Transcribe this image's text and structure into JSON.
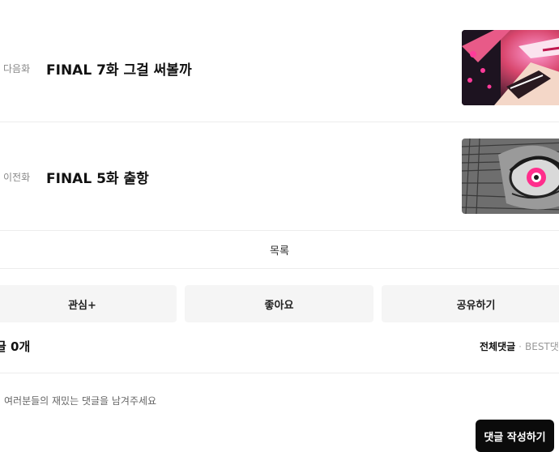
{
  "episodes": {
    "next": {
      "kind": "다음화",
      "title": "FINAL 7화 그걸 써볼까"
    },
    "prev": {
      "kind": "이전화",
      "title": "FINAL 5화 출항"
    }
  },
  "list_label": "목록",
  "actions": {
    "favorite": "관심+",
    "like": "좋아요",
    "share": "공유하기"
  },
  "comments": {
    "count_label": "글 0개",
    "tab_all": "전체댓글",
    "tab_sep": "·",
    "tab_best": "BEST댓",
    "placeholder": "여러분들의 재밌는 댓글을 남겨주세요",
    "write_button": "댓글 작성하기"
  }
}
